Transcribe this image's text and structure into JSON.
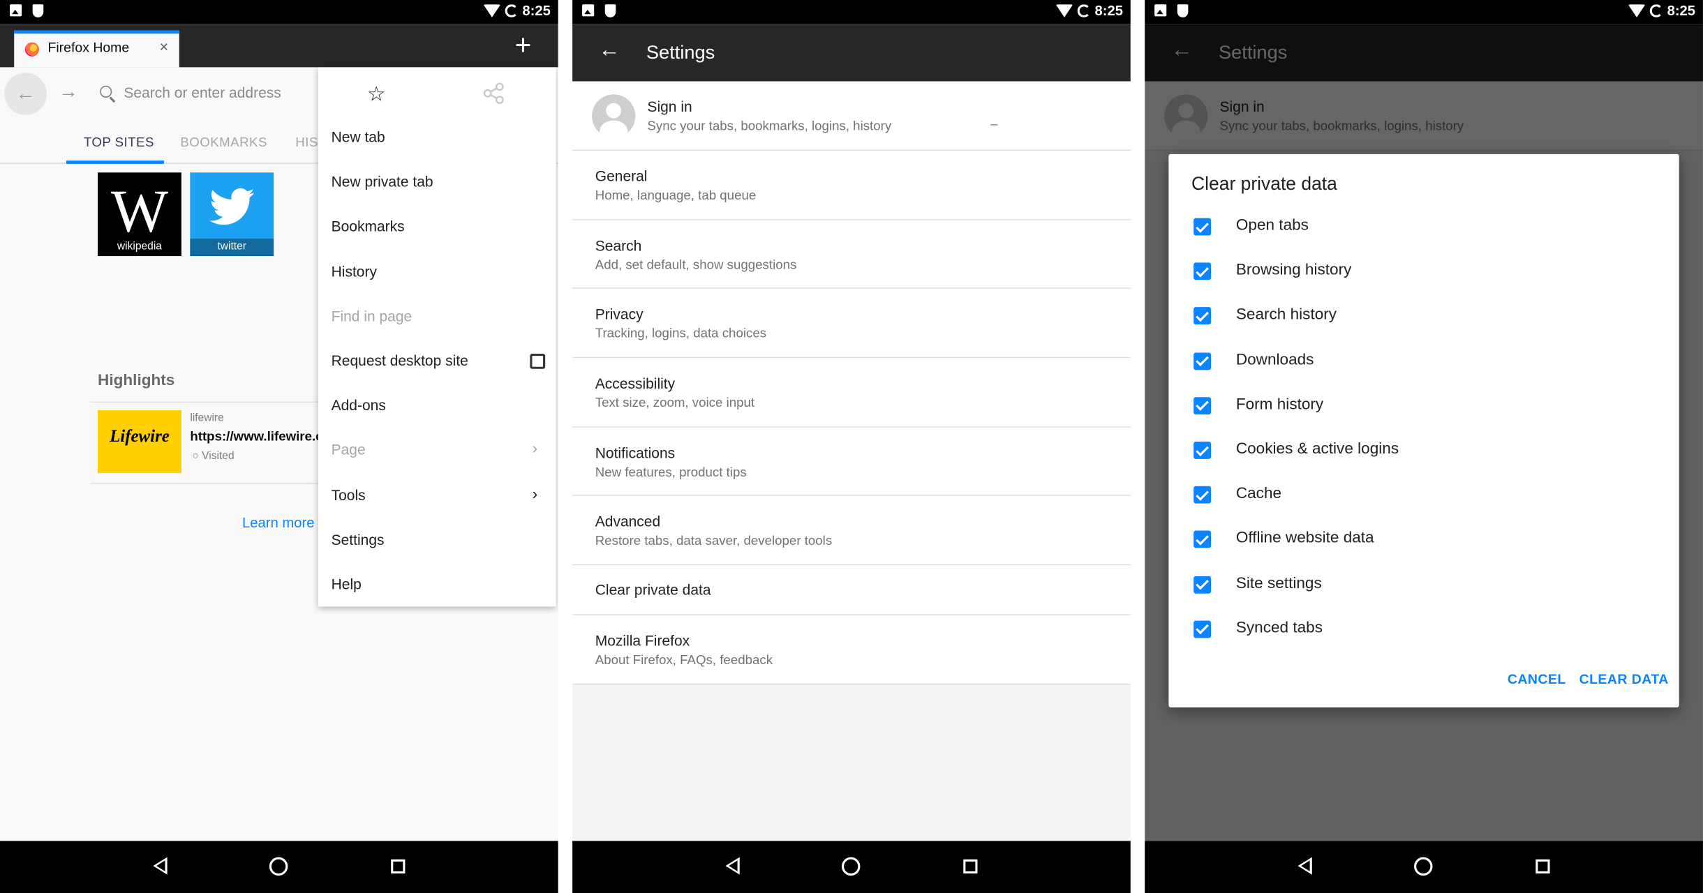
{
  "status_bar": {
    "time": "8:25"
  },
  "firefox_home": {
    "tab_title": "Firefox Home",
    "tab_close": "×",
    "new_tab_icon": "+",
    "url_placeholder": "Search or enter address",
    "panels": [
      "TOP SITES",
      "BOOKMARKS",
      "HIS"
    ],
    "top_sites": [
      {
        "label": "wikipedia",
        "glyph": "W"
      },
      {
        "label": "twitter"
      }
    ],
    "highlights": {
      "title": "Highlights",
      "site": "lifewire",
      "url": "https://www.lifewire.com",
      "status": "Visited",
      "logo_text": "Lifewire"
    },
    "learn_more": "Learn more"
  },
  "menu": {
    "items": [
      {
        "label": "New tab",
        "disabled": false
      },
      {
        "label": "New private tab",
        "disabled": false
      },
      {
        "label": "Bookmarks",
        "disabled": false
      },
      {
        "label": "History",
        "disabled": false
      },
      {
        "label": "Find in page",
        "disabled": true
      },
      {
        "label": "Request desktop site",
        "disabled": false,
        "checkbox": true
      },
      {
        "label": "Add-ons",
        "disabled": false
      },
      {
        "label": "Page",
        "disabled": true,
        "submenu": true
      },
      {
        "label": "Tools",
        "disabled": false,
        "submenu": true
      },
      {
        "label": "Settings",
        "disabled": false
      },
      {
        "label": "Help",
        "disabled": false
      }
    ]
  },
  "settings": {
    "title": "Settings",
    "sign_in": {
      "title": "Sign in",
      "subtitle": "Sync your tabs, bookmarks, logins, history",
      "dash": "–"
    },
    "rows": [
      {
        "title": "General",
        "subtitle": "Home, language, tab queue"
      },
      {
        "title": "Search",
        "subtitle": "Add, set default, show suggestions"
      },
      {
        "title": "Privacy",
        "subtitle": "Tracking, logins, data choices"
      },
      {
        "title": "Accessibility",
        "subtitle": "Text size, zoom, voice input"
      },
      {
        "title": "Notifications",
        "subtitle": "New features, product tips"
      },
      {
        "title": "Advanced",
        "subtitle": "Restore tabs, data saver, developer tools"
      },
      {
        "title": "Clear private data",
        "subtitle": ""
      },
      {
        "title": "Mozilla Firefox",
        "subtitle": "About Firefox, FAQs, feedback"
      }
    ]
  },
  "clear_dialog": {
    "title": "Clear private data",
    "options": [
      {
        "label": "Open tabs",
        "checked": true
      },
      {
        "label": "Browsing history",
        "checked": true
      },
      {
        "label": "Search history",
        "checked": true
      },
      {
        "label": "Downloads",
        "checked": true
      },
      {
        "label": "Form history",
        "checked": true
      },
      {
        "label": "Cookies & active logins",
        "checked": true
      },
      {
        "label": "Cache",
        "checked": true
      },
      {
        "label": "Offline website data",
        "checked": true
      },
      {
        "label": "Site settings",
        "checked": true
      },
      {
        "label": "Synced tabs",
        "checked": true
      }
    ],
    "cancel_label": "CANCEL",
    "confirm_label": "CLEAR DATA"
  },
  "colors": {
    "accent": "#0a84ff",
    "toolbar": "#272727",
    "statusbar": "#000000"
  },
  "icons": [
    "image-icon",
    "shield-icon",
    "wifi-icon",
    "battery-icon",
    "back-arrow-icon",
    "forward-arrow-icon",
    "search-icon",
    "star-icon",
    "share-icon",
    "chevron-right-icon",
    "checkbox-icon",
    "nav-back-icon",
    "nav-home-icon",
    "nav-recents-icon"
  ]
}
